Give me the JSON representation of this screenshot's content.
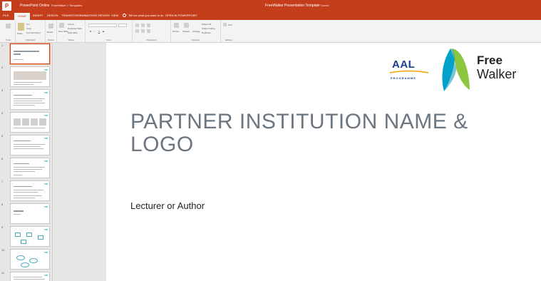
{
  "titlebar": {
    "app_icon": "powerpoint-icon",
    "app_letter": "P",
    "app_name": "PowerPoint Online",
    "quick_access": "FreeWalker > Templates",
    "doc_title": "FreeWalker Presentation Template",
    "doc_status": "Saved"
  },
  "tabs": {
    "items": [
      "FILE",
      "HOME",
      "INSERT",
      "DESIGN",
      "TRANSITIONS",
      "ANIMATIONS",
      "REVIEW",
      "VIEW"
    ],
    "active": "HOME",
    "tell_me": "Tell me what you want to do",
    "open_desktop": "OPEN IN POWERPOINT"
  },
  "ribbon": {
    "undo_label": "Undo",
    "clipboard": {
      "paste": "Paste",
      "cut": "Cut",
      "copy": "Copy",
      "format_painter": "Format Painter",
      "group": "Clipboard"
    },
    "delete": {
      "label": "Delete",
      "group": "Delete"
    },
    "slides": {
      "new_slide": "New Slide",
      "layout": "Layout",
      "duplicate": "Duplicate Slide",
      "hide": "Hide Slide",
      "group": "Slides"
    },
    "font": {
      "group": "Font",
      "bold": "B",
      "italic": "I",
      "underline": "U",
      "strike": "S"
    },
    "paragraph": {
      "group": "Paragraph"
    },
    "drawing": {
      "picture": "Picture",
      "shapes": "Shapes",
      "arrange": "Arrange",
      "quick_styles": "Quick Styles",
      "fill": "Shape Fill",
      "outline": "Shape Outline",
      "duplicate": "Duplicate",
      "group": "Drawing"
    },
    "editing": {
      "find": "Find",
      "group": "Editing"
    }
  },
  "thumbnails": [
    {
      "num": "1"
    },
    {
      "num": "2"
    },
    {
      "num": "3"
    },
    {
      "num": "4"
    },
    {
      "num": "5"
    },
    {
      "num": "6"
    },
    {
      "num": "7"
    },
    {
      "num": "8"
    },
    {
      "num": "9"
    },
    {
      "num": "10"
    },
    {
      "num": "11"
    }
  ],
  "thumbnail_logo_text": "FW",
  "slide": {
    "aal_logo": "AAL",
    "aal_sub": "PROGRAMME",
    "fw_logo_line1": "Free",
    "fw_logo_line2": "Walker",
    "title": "PARTNER INSTITUTION NAME & LOGO",
    "author": "Lecturer or Author"
  },
  "colors": {
    "accent": "#c43e1c",
    "title_text": "#6b7680",
    "aal_blue": "#1d3d8f",
    "aal_gold": "#f4a100",
    "fw_teal": "#00a2c9",
    "fw_green": "#8cc63f"
  }
}
